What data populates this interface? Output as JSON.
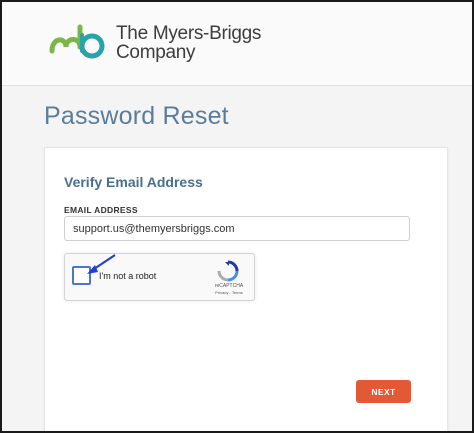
{
  "header": {
    "logo_line1_prefix": "The ",
    "logo_line1_brand": "Myers-Briggs",
    "logo_line2": "Company"
  },
  "page": {
    "title": "Password Reset"
  },
  "form": {
    "section_title": "Verify Email Address",
    "email_label": "EMAIL ADDRESS",
    "email_value": "support.us@themyersbriggs.com",
    "next_label": "NEXT"
  },
  "recaptcha": {
    "label": "I'm not a robot",
    "brand": "reCAPTCHA",
    "terms": "Privacy - Terms",
    "checked": false
  },
  "colors": {
    "logo_green": "#7ab648",
    "logo_teal": "#2aa3a8",
    "title_blue": "#5b7d9b",
    "button_orange": "#e15a34",
    "arrow_blue": "#1f3fd6"
  },
  "icons": {
    "logo": "myers-briggs-mb-logo",
    "recaptcha": "recaptcha-logo-icon",
    "annotation": "blue-arrow-pointer"
  }
}
